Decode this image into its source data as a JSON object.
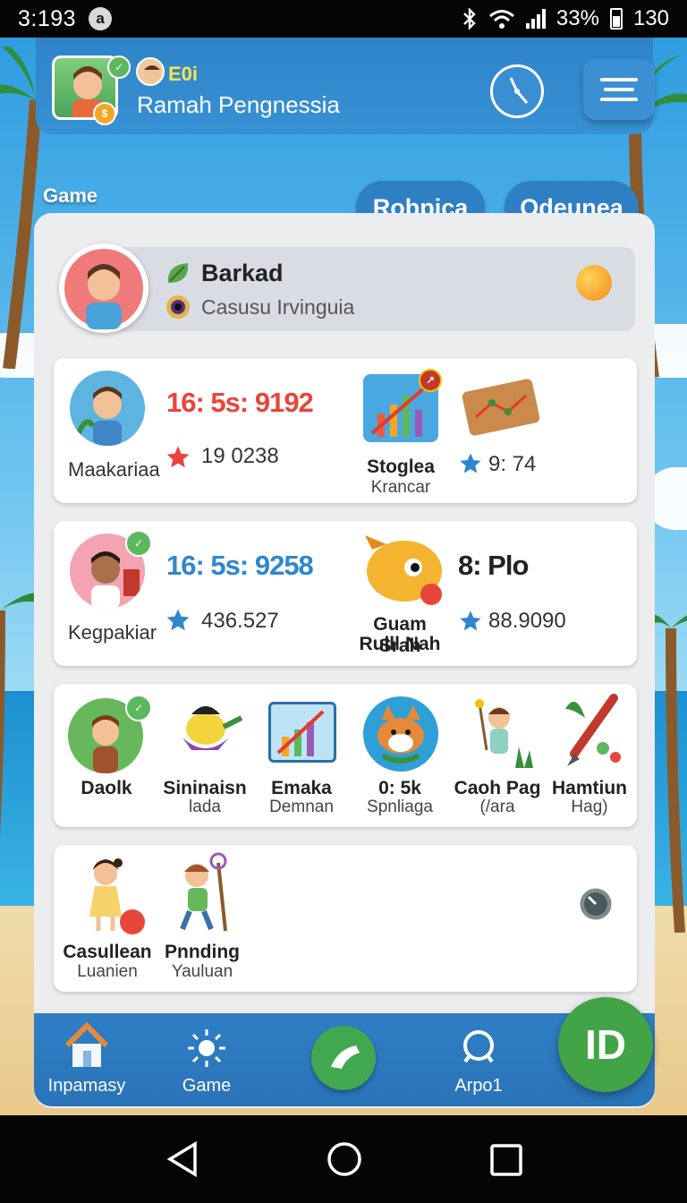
{
  "status_bar": {
    "time": "3:193",
    "notification_glyph": "a",
    "battery_percent": "33%",
    "extra": "130"
  },
  "header": {
    "user_code": "E0i",
    "user_name": "Ramah Pengnessia"
  },
  "section_label": "Game",
  "tabs": [
    {
      "label": "Robpica"
    },
    {
      "label": "Odeunea"
    }
  ],
  "profile": {
    "name": "Barkad",
    "subtitle": "Casusu Irvinguia"
  },
  "card1": {
    "player_label": "Maakariaa",
    "score": "16: 5s: 9192",
    "score_color": "#e8453b",
    "stat": "19 0238",
    "item_title": "Stoglea",
    "item_sub": "Krancar",
    "item_stat": "9: 74"
  },
  "card2": {
    "player_label": "Kegpakiar",
    "score": "16: 5s: 9258",
    "score_color": "#2f86cf",
    "stat": "436.527",
    "item_title_line1": "Guam Srah",
    "item_title_line2": "Rulll Nah",
    "big_label": "8: Plo",
    "item_stat": "88.9090"
  },
  "card3": {
    "items": [
      {
        "title": "Daolk",
        "sub": ""
      },
      {
        "title": "Sininaisn",
        "sub": "lada"
      },
      {
        "title": "Emaka",
        "sub": "Demnan"
      },
      {
        "title": "0: 5k",
        "sub": "Spnliaga"
      },
      {
        "title": "Caoh Pag",
        "sub": "(/ara"
      },
      {
        "title": "Hamtiun",
        "sub": "Hag)"
      }
    ]
  },
  "card4": {
    "items": [
      {
        "title": "Casullean",
        "sub": "Luanien"
      },
      {
        "title": "Pnnding",
        "sub": "Yauluan"
      }
    ]
  },
  "bottom_nav": {
    "items": [
      {
        "label": "Inpamasy",
        "icon": "home-icon"
      },
      {
        "label": "Game",
        "icon": "sun-icon"
      },
      {
        "label": "",
        "icon": "phone-icon"
      },
      {
        "label": "Arpo1",
        "icon": "user-icon"
      }
    ],
    "fab_label": "ID"
  },
  "colors": {
    "primary_blue": "#2f7fc5",
    "accent_green": "#42a447",
    "star_red": "#e8453b",
    "star_blue": "#2f86cf"
  }
}
